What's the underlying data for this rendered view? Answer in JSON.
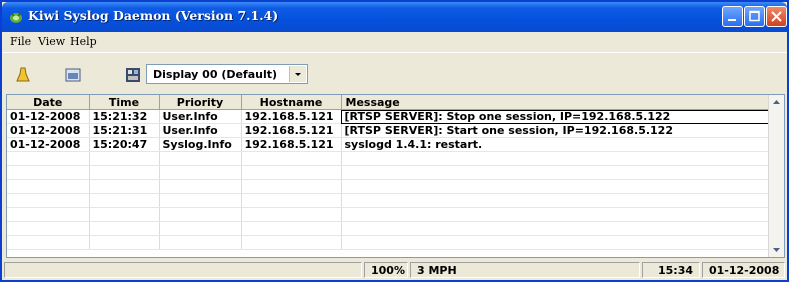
{
  "window": {
    "title": "Kiwi Syslog Daemon (Version 7.1.4)"
  },
  "menu": {
    "file": "File",
    "view": "View",
    "help": "Help"
  },
  "toolbar": {
    "display_select": "Display 00 (Default)"
  },
  "table": {
    "headers": {
      "date": "Date",
      "time": "Time",
      "priority": "Priority",
      "hostname": "Hostname",
      "message": "Message"
    },
    "rows": [
      {
        "date": "01-12-2008",
        "time": "15:21:32",
        "priority": "User.Info",
        "hostname": "192.168.5.121",
        "message": "[RTSP SERVER]: Stop one session, IP=192.168.5.122"
      },
      {
        "date": "01-12-2008",
        "time": "15:21:31",
        "priority": "User.Info",
        "hostname": "192.168.5.121",
        "message": "[RTSP SERVER]: Start one session, IP=192.168.5.122"
      },
      {
        "date": "01-12-2008",
        "time": "15:20:47",
        "priority": "Syslog.Info",
        "hostname": "192.168.5.121",
        "message": "syslogd 1.4.1: restart."
      }
    ]
  },
  "status": {
    "percent": "100%",
    "rate": "3 MPH",
    "time": "15:34",
    "date": "01-12-2008"
  },
  "colors": {
    "titlebar": "#0451dd",
    "close_button": "#d2401e"
  }
}
